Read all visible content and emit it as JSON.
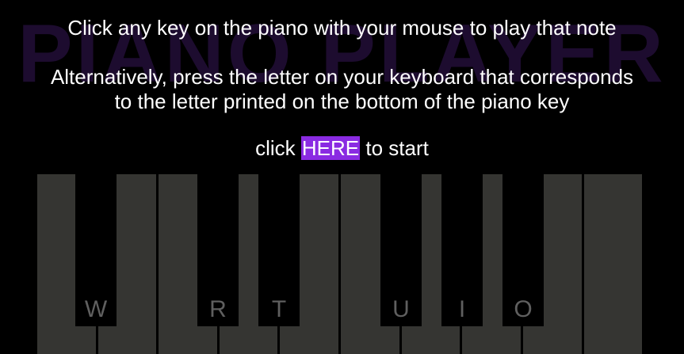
{
  "watermark": "PIANO PLAYER",
  "instructions": {
    "line1": "Click any key on the piano with your mouse to play that note",
    "line2": "Alternatively, press the letter on your keyboard that corresponds",
    "line3": "to the letter printed on the bottom of the piano key",
    "start_prefix": "click ",
    "start_link": "HERE",
    "start_suffix": " to start"
  },
  "colors": {
    "background": "#000000",
    "white_key": "#353532",
    "black_key": "#000000",
    "accent": "#8a2be2",
    "watermark": "#1d0c2f",
    "key_letter": "#5f5f5f"
  },
  "black_key_letters": [
    "W",
    "",
    "R",
    "T",
    "",
    "U",
    "I",
    "O",
    ""
  ]
}
